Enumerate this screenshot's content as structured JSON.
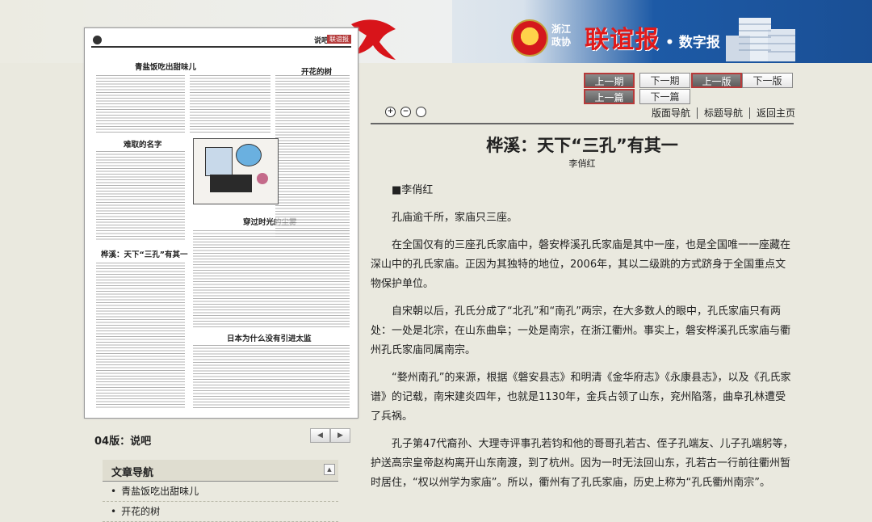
{
  "header": {
    "region_line1": "浙江",
    "region_line2": "政协",
    "paper_name": "联谊报",
    "suffix": "• 数字报"
  },
  "thumbnail": {
    "page_title": "说吧",
    "page_tag": "联谊报",
    "headlines": [
      "青盐饭吃出甜味儿",
      "开花的树",
      "难取的名字",
      "桦溪：天下“三孔”有其一",
      "穿过时光的尘雾",
      "日本为什么没有引进太监"
    ]
  },
  "edition": {
    "label": "04版：说吧",
    "prev_arrow": "◀",
    "next_arrow": "▶"
  },
  "article_nav": {
    "title": "文章导航",
    "collapse": "▲",
    "items": [
      "青盐饭吃出甜味儿",
      "开花的树"
    ]
  },
  "nav": {
    "prev_issue": "上一期",
    "next_issue": "下一期",
    "prev_page": "上一版",
    "next_page": "下一版",
    "prev_article": "上一篇",
    "next_article": "下一篇",
    "layout_nav": "版面导航",
    "title_nav": "标题导航",
    "home": "返回主页"
  },
  "zoom": {
    "in": "+",
    "out": "−",
    "reset": ""
  },
  "article": {
    "title": "桦溪：天下“三孔”有其一",
    "author": "李俏红",
    "paragraphs": [
      "■李俏红",
      "孔庙逾千所，家庙只三座。",
      "在全国仅有的三座孔氏家庙中，磐安桦溪孔氏家庙是其中一座，也是全国唯一一座藏在深山中的孔氏家庙。正因为其独特的地位，2006年，其以二级跳的方式跻身于全国重点文物保护单位。",
      "自宋朝以后，孔氏分成了“北孔”和“南孔”两宗，在大多数人的眼中，孔氏家庙只有两处：一处是北宗，在山东曲阜；一处是南宗，在浙江衢州。事实上，磐安桦溪孔氏家庙与衢州孔氏家庙同属南宗。",
      "“婺州南孔”的来源，根据《磐安县志》和明清《金华府志》《永康县志》，以及《孔氏家谱》的记载，南宋建炎四年，也就是1130年，金兵占领了山东，兖州陷落，曲阜孔林遭受了兵祸。",
      "孔子第47代裔孙、大理寺评事孔若钧和他的哥哥孔若古、侄子孔端友、儿子孔端躬等，护送高宗皇帝赵构离开山东南渡，到了杭州。因为一时无法回山东，孔若古一行前往衢州暂时居住，“权以州学为家庙”。所以，衢州有了孔氏家庙，历史上称为“孔氏衢州南宗”。"
    ]
  }
}
